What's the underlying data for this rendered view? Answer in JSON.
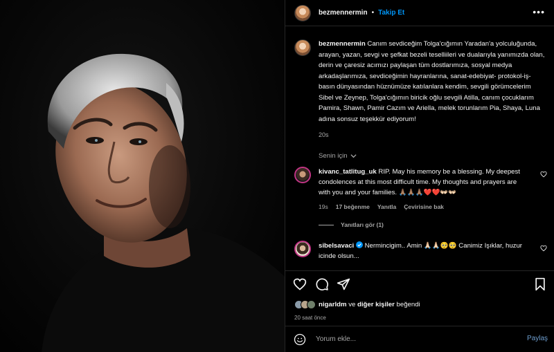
{
  "post": {
    "username": "bezmennermin",
    "dot": "•",
    "follow_label": "Takip Et",
    "more_label": "•••",
    "caption": "Canım sevdiceğim Tolga'cığımın Yaradan'a yolculuğunda, arayan, yazan, sevgi ve şefkat bezeli teselliileri ve dualarıyla yanımızda olan, derin ve çaresiz acımızı paylaşan tüm dostlarımıza, sosyal medya arkadaşlarımıza, sevdiceğimin hayranlarına, sanat-edebiyat- protokol-iş- basın dünyasından hüznümüze katılanlara kendim, sevgili görümcelerim Sibel ve Zeynep, Tolga'cığımın biricik oğlu sevgili Atilla, canım çocuklarım Pamira, Shawn, Pamir Cazım ve Ariella, melek torunlarım Pia, Shaya, Luna adına sonsuz teşekkür ediyorum!",
    "caption_time": "20s"
  },
  "filter": {
    "label": "Senin için"
  },
  "comments": [
    {
      "username": "kivanc_tatlitug_uk",
      "text": "RIP. May his memory be a blessing. My deepest condolences at this most difficult time. My thoughts and prayers are with you and your families. 🙏🏽🙏🏽🙏🏽❤️❤️👐🏻👐🏻",
      "time": "19s",
      "likes": "17 beğenme",
      "reply": "Yanıtla",
      "translate": "Çevirisine bak"
    },
    {
      "username": "sibelsavaci",
      "text": "Nermincigim.. Amin 🙏🏻🙏🏻🥺🥺 Canimiz Işıklar, huzur icinde olsun..."
    }
  ],
  "replies_label": "Yanıtları gör (1)",
  "likes": {
    "user": "nigarldm",
    "mid": "ve",
    "others": "diğer kişiler",
    "end": "beğendi"
  },
  "post_time": "20 saat önce",
  "composer": {
    "placeholder": "Yorum ekle...",
    "post_label": "Paylaş"
  },
  "colors": {
    "accent": "#0095f6",
    "muted": "#a8a8a8",
    "border": "#262626"
  },
  "icons": [
    "heart-icon",
    "comment-icon",
    "share-icon",
    "bookmark-icon",
    "emoji-icon",
    "verified-icon",
    "chevron-down-icon"
  ]
}
